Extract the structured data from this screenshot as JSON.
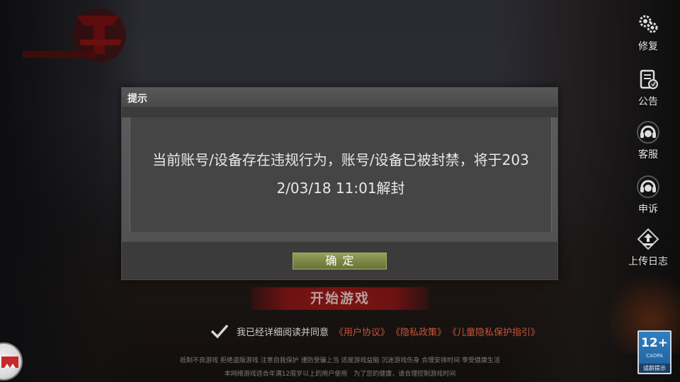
{
  "side_menu": [
    {
      "label": "修复",
      "icon": "gears-icon"
    },
    {
      "label": "公告",
      "icon": "notice-icon"
    },
    {
      "label": "客服",
      "icon": "headset-icon"
    },
    {
      "label": "申诉",
      "icon": "appeal-headset-icon"
    },
    {
      "label": "上传日志",
      "icon": "upload-icon"
    }
  ],
  "dialog": {
    "title": "提示",
    "message_line1": "当前账号/设备存在违规行为，账号/设备已被封禁，将于203",
    "message_line2": "2/03/18 11:01解封",
    "ok_label": "确定"
  },
  "start_button": "开始游戏",
  "agreement": {
    "text": "我已经详细阅读并同意",
    "links": [
      "《用户协议》",
      "《隐私政策》",
      "《儿童隐私保护指引》"
    ]
  },
  "footer": {
    "line1": "抵制不良游戏 拒绝盗版游戏 注意自我保护 谨防受骗上当 适度游戏益脑 沉迷游戏伤身 合理安排时间 享受健康生活",
    "line2": "本网络游戏适合年满12周岁以上的用户使用　为了您的健康，请合理控制游戏时间"
  },
  "age_badge": {
    "rating": "12+",
    "org": "CADPA",
    "label": "适龄提示"
  },
  "colors": {
    "accent_green": "#7b8544",
    "link_red": "#c8553a",
    "start_red": "#7a1414"
  }
}
